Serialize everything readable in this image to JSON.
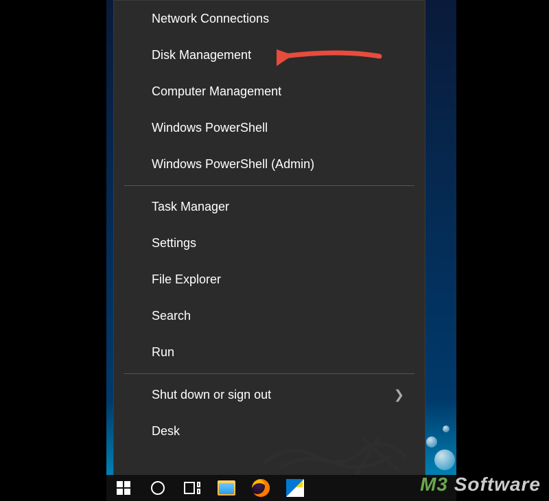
{
  "menu": {
    "group1": [
      "Network Connections",
      "Disk Management",
      "Computer Management",
      "Windows PowerShell",
      "Windows PowerShell (Admin)"
    ],
    "group2": [
      "Task Manager",
      "Settings",
      "File Explorer",
      "Search",
      "Run"
    ],
    "group3": {
      "shutdown": "Shut down or sign out",
      "desktop_partial": "Desk"
    }
  },
  "annotation": {
    "arrow_target": "Disk Management",
    "arrow_color": "#e74c3c"
  },
  "taskbar": {
    "icons": [
      "start",
      "cortana",
      "task-view",
      "file-explorer",
      "firefox",
      "edge"
    ]
  },
  "watermark": {
    "brand_left": "M3",
    "brand_right": " Software"
  },
  "colors": {
    "menu_bg": "#2b2b2b",
    "text": "#ffffff",
    "arrow": "#e74c3c",
    "scribble": "#333333"
  }
}
